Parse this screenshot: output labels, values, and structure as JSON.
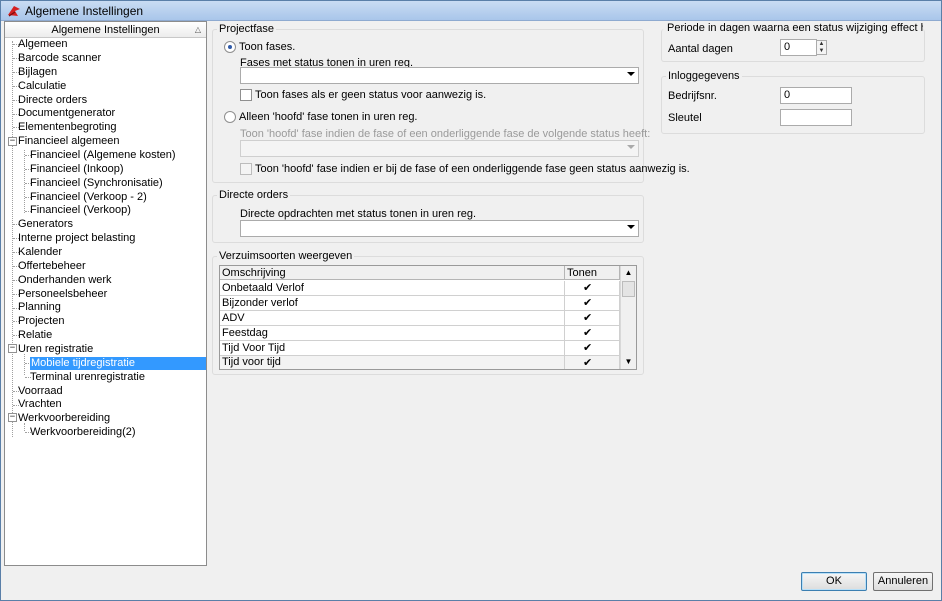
{
  "window": {
    "title": "Algemene Instellingen"
  },
  "tree": {
    "header": "Algemene Instellingen",
    "items": [
      {
        "label": "Algemeen"
      },
      {
        "label": "Barcode scanner"
      },
      {
        "label": "Bijlagen"
      },
      {
        "label": "Calculatie"
      },
      {
        "label": "Directe orders"
      },
      {
        "label": "Documentgenerator"
      },
      {
        "label": "Elementenbegroting"
      },
      {
        "label": "Financieel algemeen"
      },
      {
        "label": "Financieel (Algemene kosten)"
      },
      {
        "label": "Financieel (Inkoop)"
      },
      {
        "label": "Financieel (Synchronisatie)"
      },
      {
        "label": "Financieel (Verkoop - 2)"
      },
      {
        "label": "Financieel (Verkoop)"
      },
      {
        "label": "Generators"
      },
      {
        "label": "Interne project belasting"
      },
      {
        "label": "Kalender"
      },
      {
        "label": "Offertebeheer"
      },
      {
        "label": "Onderhanden werk"
      },
      {
        "label": "Personeelsbeheer"
      },
      {
        "label": "Planning"
      },
      {
        "label": "Projecten"
      },
      {
        "label": "Relatie"
      },
      {
        "label": "Uren registratie"
      },
      {
        "label": "Mobiele tijdregistratie"
      },
      {
        "label": "Terminal urenregistratie"
      },
      {
        "label": "Voorraad"
      },
      {
        "label": "Vrachten"
      },
      {
        "label": "Werkvoorbereiding"
      },
      {
        "label": "Werkvoorbereiding(2)"
      }
    ],
    "selected": "Mobiele tijdregistratie"
  },
  "projectfase": {
    "title": "Projectfase",
    "radio_toon_fases": "Toon fases.",
    "fases_status_label": "Fases met status tonen in uren reg.",
    "fases_status_value": "",
    "checkbox_geen_status": "Toon fases als er geen status voor aanwezig is.",
    "radio_alleen_hoofd": "Alleen 'hoofd' fase tonen in uren reg.",
    "hoofd_status_label": "Toon 'hoofd' fase indien de fase of een onderliggende fase de volgende status heeft:",
    "hoofd_status_value": "",
    "checkbox_hoofd_geen_status": "Toon 'hoofd' fase indien er bij de fase of een onderliggende fase geen status aanwezig is."
  },
  "directe_orders": {
    "title": "Directe orders",
    "label": "Directe opdrachten met status tonen in uren reg.",
    "value": ""
  },
  "verzuim": {
    "title": "Verzuimsoorten weergeven",
    "columns": [
      "Omschrijving",
      "Tonen"
    ],
    "rows": [
      {
        "omschrijving": "Onbetaald Verlof",
        "tonen": "✔"
      },
      {
        "omschrijving": "Bijzonder verlof",
        "tonen": "✔"
      },
      {
        "omschrijving": "ADV",
        "tonen": "✔"
      },
      {
        "omschrijving": "Feestdag",
        "tonen": "✔"
      },
      {
        "omschrijving": "Tijd Voor Tijd",
        "tonen": "✔"
      },
      {
        "omschrijving": "Tijd voor tijd",
        "tonen": "✔"
      }
    ]
  },
  "periode": {
    "title": "Periode in dagen waarna een status wijziging effect heeft op het",
    "aantal_dagen_label": "Aantal dagen",
    "aantal_dagen_value": "0"
  },
  "inlog": {
    "title": "Inloggegevens",
    "bedrijfsnr_label": "Bedrijfsnr.",
    "bedrijfsnr_value": "0",
    "sleutel_label": "Sleutel",
    "sleutel_value": ""
  },
  "buttons": {
    "ok": "OK",
    "annuleren": "Annuleren"
  },
  "colors": {
    "selection": "#3399ff",
    "titlebar": "#b9d1ee",
    "accent_icon": "#d42020"
  }
}
